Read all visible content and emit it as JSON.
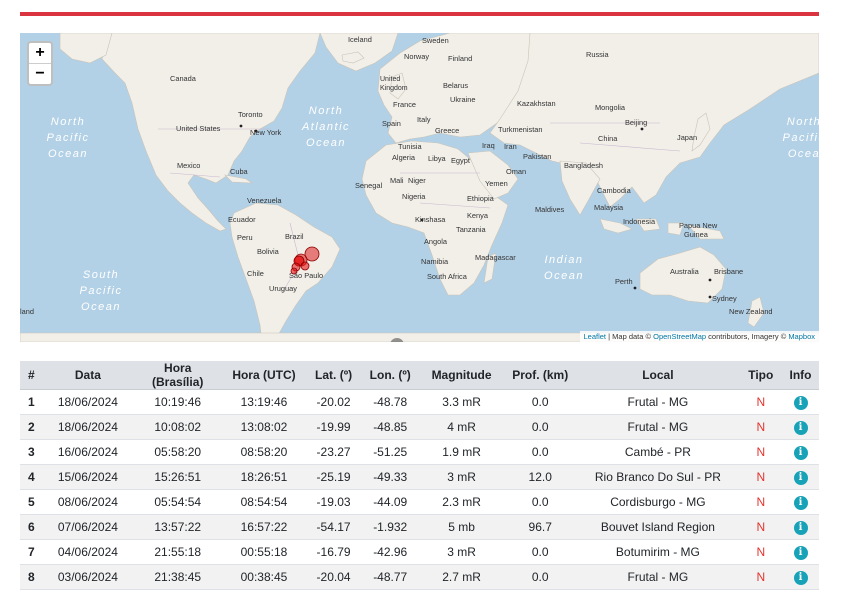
{
  "map": {
    "zoom_in": "+",
    "zoom_out": "−",
    "attribution": {
      "leaflet": "Leaflet",
      "text": " | Map data © ",
      "osm": "OpenStreetMap",
      "imagery": " contributors, Imagery © ",
      "mapbox": "Mapbox"
    },
    "labels": {
      "iceland": "Iceland",
      "sweden": "Sweden",
      "norway": "Norway",
      "finland": "Finland",
      "russia": "Russia",
      "canada": "Canada",
      "uk": "United Kingdom",
      "belarus": "Belarus",
      "ukraine": "Ukraine",
      "france": "France",
      "kazakhstan": "Kazakhstan",
      "mongolia": "Mongolia",
      "spain": "Spain",
      "italy": "Italy",
      "greece": "Greece",
      "turkmenistan": "Turkmenistan",
      "beijing": "Beijing",
      "japan": "Japan",
      "china": "China",
      "toronto": "Toronto",
      "usa": "United States",
      "newyork": "New York",
      "north_atlantic_1": "North",
      "north_atlantic_2": "Atlantic",
      "north_atlantic_3": "Ocean",
      "npac_w_1": "North",
      "npac_w_2": "Pacific",
      "npac_w_3": "Ocean",
      "npac_e_1": "North",
      "npac_e_2": "Pacific",
      "npac_e_3": "Ocea",
      "tunisia": "Tunisia",
      "iraq": "Iraq",
      "iran": "Iran",
      "algeria": "Algeria",
      "libya": "Libya",
      "egypt": "Egypt",
      "pakistan": "Pakistan",
      "mexico": "Mexico",
      "cuba": "Cuba",
      "oman": "Oman",
      "bangladesh": "Bangladesh",
      "yemen": "Yemen",
      "senegal": "Senegal",
      "mali": "Mali",
      "niger": "Niger",
      "venezuela": "Venezuela",
      "nigeria": "Nigeria",
      "ethiopia": "Ethiopia",
      "cambodia": "Cambodia",
      "ecuador": "Ecuador",
      "kenya": "Kenya",
      "maldives": "Maldives",
      "malaysia": "Malaysia",
      "kinshasa": "Kinshasa",
      "indonesia": "Indonesia",
      "peru": "Peru",
      "brazil": "Brazil",
      "tanzania": "Tanzania",
      "papua": "Papua New",
      "guinea": "Guinea",
      "angola": "Angola",
      "bolivia": "Bolivia",
      "namibia": "Namibia",
      "madagascar": "Madagascar",
      "indian_1": "Indian",
      "indian_2": "Ocean",
      "australia": "Australia",
      "brisbane": "Brisbane",
      "spac_1": "South",
      "spac_2": "Pacific",
      "spac_3": "Ocean",
      "chile": "Chile",
      "saopaulo": "São Paulo",
      "southafrica": "South Africa",
      "perth": "Perth",
      "sydney": "Sydney",
      "uruguay": "Uruguay",
      "newzealand": "New Zealand",
      "island": "land"
    }
  },
  "table": {
    "headers": {
      "num": "#",
      "data": "Data",
      "hora_brasilia": "Hora (Brasília)",
      "hora_utc": "Hora (UTC)",
      "lat": "Lat. (º)",
      "lon": "Lon. (º)",
      "magnitude": "Magnitude",
      "prof": "Prof. (km)",
      "local": "Local",
      "tipo": "Tipo",
      "info": "Info"
    },
    "rows": [
      {
        "num": "1",
        "data": "18/06/2024",
        "hb": "10:19:46",
        "hu": "13:19:46",
        "lat": "-20.02",
        "lon": "-48.78",
        "mag": "3.3 mR",
        "prof": "0.0",
        "local": "Frutal - MG",
        "tipo": "N"
      },
      {
        "num": "2",
        "data": "18/06/2024",
        "hb": "10:08:02",
        "hu": "13:08:02",
        "lat": "-19.99",
        "lon": "-48.85",
        "mag": "4 mR",
        "prof": "0.0",
        "local": "Frutal - MG",
        "tipo": "N"
      },
      {
        "num": "3",
        "data": "16/06/2024",
        "hb": "05:58:20",
        "hu": "08:58:20",
        "lat": "-23.27",
        "lon": "-51.25",
        "mag": "1.9 mR",
        "prof": "0.0",
        "local": "Cambé - PR",
        "tipo": "N"
      },
      {
        "num": "4",
        "data": "15/06/2024",
        "hb": "15:26:51",
        "hu": "18:26:51",
        "lat": "-25.19",
        "lon": "-49.33",
        "mag": "3 mR",
        "prof": "12.0",
        "local": "Rio Branco Do Sul - PR",
        "tipo": "N"
      },
      {
        "num": "5",
        "data": "08/06/2024",
        "hb": "05:54:54",
        "hu": "08:54:54",
        "lat": "-19.03",
        "lon": "-44.09",
        "mag": "2.3 mR",
        "prof": "0.0",
        "local": "Cordisburgo - MG",
        "tipo": "N"
      },
      {
        "num": "6",
        "data": "07/06/2024",
        "hb": "13:57:22",
        "hu": "16:57:22",
        "lat": "-54.17",
        "lon": "-1.932",
        "mag": "5 mb",
        "prof": "96.7",
        "local": "Bouvet Island Region",
        "tipo": "N"
      },
      {
        "num": "7",
        "data": "04/06/2024",
        "hb": "21:55:18",
        "hu": "00:55:18",
        "lat": "-16.79",
        "lon": "-42.96",
        "mag": "3 mR",
        "prof": "0.0",
        "local": "Botumirim - MG",
        "tipo": "N"
      },
      {
        "num": "8",
        "data": "03/06/2024",
        "hb": "21:38:45",
        "hu": "00:38:45",
        "lat": "-20.04",
        "lon": "-48.77",
        "mag": "2.7 mR",
        "prof": "0.0",
        "local": "Frutal - MG",
        "tipo": "N"
      }
    ],
    "info_glyph": "i"
  }
}
